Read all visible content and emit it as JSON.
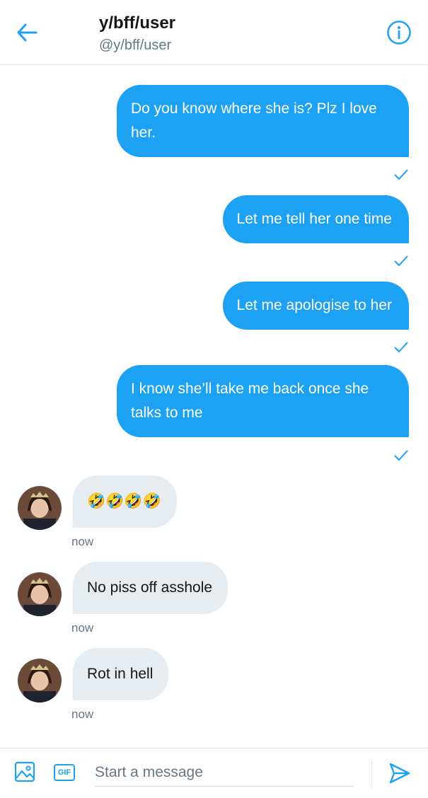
{
  "header": {
    "title": "y/bff/user",
    "handle": "@y/bff/user"
  },
  "messages": {
    "m1": "Do you know where she is? Plz I love her.",
    "m2": "Let me tell her one time",
    "m3": "Let me apologise to her",
    "m4": "I know she’ll take me back once she talks to me",
    "r1": "🤣🤣🤣🤣",
    "r2": "No piss off asshole",
    "r3": "Rot in hell",
    "r1_time": "now",
    "r2_time": "now",
    "r3_time": "now"
  },
  "composer": {
    "placeholder": "Start a message",
    "gif_label": "GIF"
  },
  "colors": {
    "accent": "#1da1f2",
    "incoming_bubble": "#e6ecf0",
    "secondary_text": "#657786"
  }
}
